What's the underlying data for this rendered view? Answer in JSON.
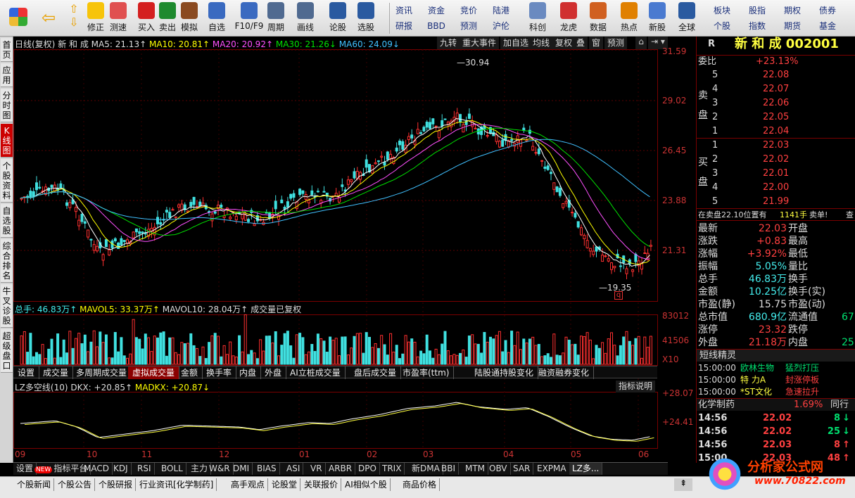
{
  "toolbar": {
    "buttons": [
      {
        "label": "修正",
        "color": "#f7c40a"
      },
      {
        "label": "测速",
        "color": "#e05050"
      },
      {
        "label": "买入",
        "color": "#d42020"
      },
      {
        "label": "卖出",
        "color": "#1e8a2e"
      },
      {
        "label": "模拟",
        "color": "#8a4a20"
      },
      {
        "label": "自选",
        "color": "#3a6ac0"
      },
      {
        "label": "F10/F9",
        "color": "#3a6ac0"
      },
      {
        "label": "周期",
        "color": "#506a90"
      },
      {
        "label": "画线",
        "color": "#506a90"
      },
      {
        "label": "论股",
        "color": "#2a5aa0"
      },
      {
        "label": "选股",
        "color": "#2a5aa0"
      }
    ],
    "grid1": [
      "资讯",
      "资金",
      "竞价",
      "陆港"
    ],
    "grid2": [
      "研报",
      "BBD",
      "预测",
      "沪伦"
    ],
    "buttons2": [
      {
        "label": "科创",
        "color": "#6a8ac0"
      },
      {
        "label": "龙虎",
        "color": "#d03030"
      },
      {
        "label": "数据",
        "color": "#d06020"
      },
      {
        "label": "热点",
        "color": "#e08000"
      },
      {
        "label": "新股",
        "color": "#4a7ad0"
      },
      {
        "label": "全球",
        "color": "#2a5aa0"
      }
    ],
    "grid3": [
      "板块",
      "股指",
      "期权",
      "债券"
    ],
    "grid4": [
      "个股",
      "指数",
      "期货",
      "基金"
    ]
  },
  "left_tabs": [
    "首页",
    "应用",
    "分时图",
    "K线图",
    "个股资料",
    "自选股",
    "综合排名",
    "牛叉诊股",
    "超级盘口"
  ],
  "chart": {
    "header": {
      "period": "日线(复权)",
      "name": "新 和 成",
      "ma5": "MA5: 21.13↑",
      "ma10": "MA10: 20.81↑",
      "ma20": "MA20: 20.92↑",
      "ma30": "MA30: 21.26↓",
      "ma60": "MA60: 24.09↓"
    },
    "pills": [
      "九转",
      "重大事件",
      "加自选",
      "均线",
      "复权",
      "叠",
      "窗",
      "预测"
    ],
    "y_ticks": [
      "31.59",
      "29.02",
      "26.45",
      "23.88",
      "21.31"
    ],
    "high_label": "30.94",
    "low_label": "19.35",
    "vol_header": {
      "vol": "总手: 46.83万↑",
      "mavol5": "MAVOL5: 33.37万↑",
      "mavol10": "MAVOL10: 28.04万↑",
      "note": "成交量已复权"
    },
    "vol_ticks": [
      "83012",
      "41506",
      "X10"
    ],
    "sub_tabs": [
      "设置",
      "成交量",
      "多周期成交量",
      "虚拟成交量",
      "金额",
      "换手率",
      "内盘",
      "外盘",
      "AI立桩成交量",
      "盘后成交量",
      "市盈率(ttm)",
      "陆股通持股变化",
      "融资融券变化"
    ],
    "ind_header": {
      "name": "LZ多空线(10) DKX: +20.85↑",
      "madkx": "MADKX: +20.87↓",
      "explain": "指标说明"
    },
    "ind_ticks": [
      "+28.07",
      "+24.41"
    ],
    "x_labels": [
      "09",
      "10",
      "11",
      "12",
      "01",
      "02",
      "03",
      "04",
      "05",
      "06"
    ],
    "bottom_tabs": [
      "设置",
      "指标平台",
      "MACD",
      "KDJ",
      "RSI",
      "BOLL",
      "主力",
      "W&R",
      "DMI",
      "BIAS",
      "ASI",
      "VR",
      "ARBR",
      "DPO",
      "TRIX",
      "新DMA",
      "BBI",
      "MTM",
      "OBV",
      "SAR",
      "EXPMA",
      "LZ多..."
    ],
    "new_badge": "NEW"
  },
  "rpanel": {
    "r": "R",
    "title": "新 和 成 002001",
    "weibi_label": "委比",
    "weibi": "+23.13%",
    "sell_label": "卖盘",
    "buy_label": "买盘",
    "sells": [
      {
        "n": "5",
        "p": "22.08"
      },
      {
        "n": "4",
        "p": "22.07"
      },
      {
        "n": "3",
        "p": "22.06"
      },
      {
        "n": "2",
        "p": "22.05"
      },
      {
        "n": "1",
        "p": "22.04"
      }
    ],
    "buys": [
      {
        "n": "1",
        "p": "22.03"
      },
      {
        "n": "2",
        "p": "22.02"
      },
      {
        "n": "3",
        "p": "22.01"
      },
      {
        "n": "4",
        "p": "22.00"
      },
      {
        "n": "5",
        "p": "21.99"
      }
    ],
    "notice": "在卖盘22.10位置有",
    "notice_qty": "1141手",
    "notice_tail": "卖单!",
    "notice_btn": "查",
    "stats": [
      {
        "l": "最新",
        "v": "22.03",
        "l2": "开盘",
        "v2": ""
      },
      {
        "l": "涨跌",
        "v": "+0.83",
        "l2": "最高",
        "v2": ""
      },
      {
        "l": "涨幅",
        "v": "+3.92%",
        "l2": "最低",
        "v2": ""
      },
      {
        "l": "振幅",
        "v": "5.05%",
        "l2": "量比",
        "v2": ""
      },
      {
        "l": "总手",
        "v": "46.83万",
        "l2": "换手",
        "v2": ""
      },
      {
        "l": "金额",
        "v": "10.25亿",
        "l2": "换手(实)",
        "v2": ""
      },
      {
        "l": "市盈(静)",
        "v": "15.75",
        "l2": "市盈(动)",
        "v2": ""
      },
      {
        "l": "总市值",
        "v": "680.9亿",
        "l2": "流通值",
        "v2": "67"
      },
      {
        "l": "涨停",
        "v": "23.32",
        "l2": "跌停",
        "v2": ""
      },
      {
        "l": "外盘",
        "v": "21.18万",
        "l2": "内盘",
        "v2": "25"
      }
    ],
    "jinling": "短线精灵",
    "alerts": [
      {
        "t": "15:00:00",
        "s": "欧林生物",
        "a": "猛烈打压"
      },
      {
        "t": "15:00:00",
        "s": "特 力A",
        "a": "封涨停板"
      },
      {
        "t": "15:00:00",
        "s": "*ST文化",
        "a": "急速拉升"
      }
    ],
    "sector": "化学制药",
    "sector_pct": "1.69%",
    "sector_btn": "同行",
    "trades": [
      {
        "t": "14:56",
        "p": "22.02",
        "q": "8",
        "d": "down"
      },
      {
        "t": "14:56",
        "p": "22.02",
        "q": "25",
        "d": "down"
      },
      {
        "t": "14:56",
        "p": "22.03",
        "q": "8",
        "d": "up"
      },
      {
        "t": "15:00",
        "p": "22.03",
        "q": "48",
        "d": "up"
      }
    ]
  },
  "bottom": {
    "news": [
      "个股新闻",
      "个股公告",
      "个股研报",
      "行业资讯[化学制药]",
      "高手观点",
      "论股堂",
      "关联报价",
      "AI相似个股",
      "商品价格"
    ],
    "logo_text": "分析家公式网",
    "logo_url": "www.70822.com"
  }
}
